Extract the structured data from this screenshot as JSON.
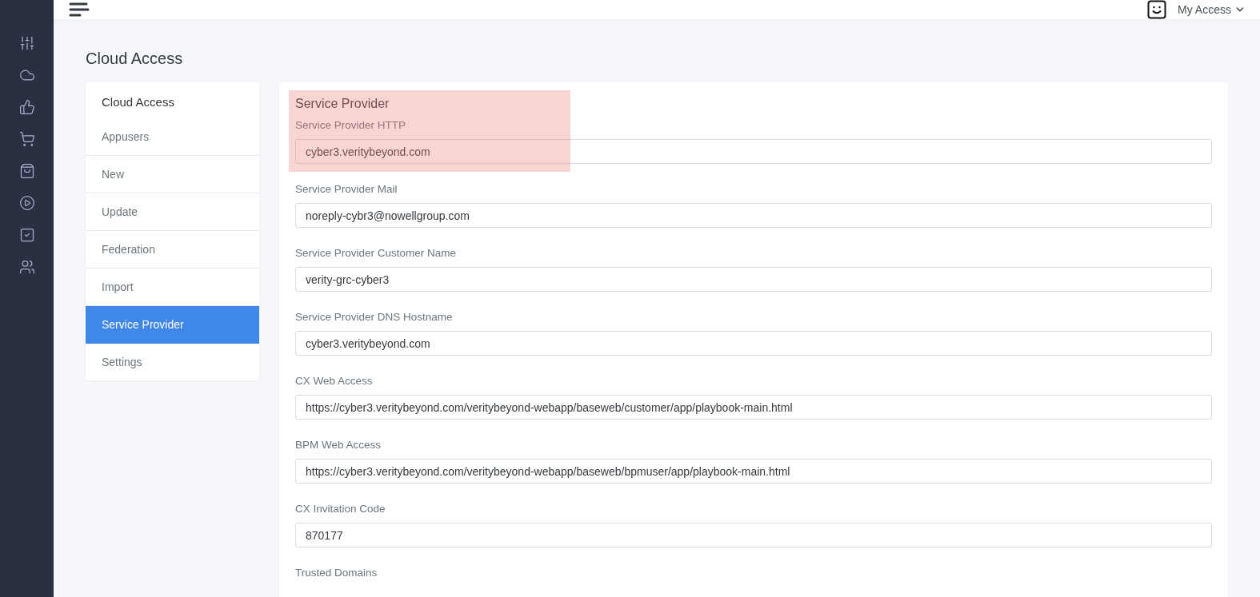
{
  "header": {
    "user_menu": "My Access"
  },
  "page_title": "Cloud Access",
  "menu": {
    "title": "Cloud Access",
    "items": [
      {
        "label": "Appusers",
        "selected": false
      },
      {
        "label": "New",
        "selected": false
      },
      {
        "label": "Update",
        "selected": false
      },
      {
        "label": "Federation",
        "selected": false
      },
      {
        "label": "Import",
        "selected": false
      },
      {
        "label": "Service Provider",
        "selected": true
      },
      {
        "label": "Settings",
        "selected": false
      }
    ]
  },
  "form": {
    "title": "Service Provider",
    "highlighted": true,
    "fields": [
      {
        "label": "Service Provider HTTP",
        "value": "cyber3.veritybeyond.com"
      },
      {
        "label": "Service Provider Mail",
        "value": "noreply-cybr3@nowellgroup.com"
      },
      {
        "label": "Service Provider Customer Name",
        "value": "verity-grc-cyber3"
      },
      {
        "label": "Service Provider DNS Hostname",
        "value": "cyber3.veritybeyond.com"
      },
      {
        "label": "CX Web Access",
        "value": "https://cyber3.veritybeyond.com/veritybeyond-webapp/baseweb/customer/app/playbook-main.html"
      },
      {
        "label": "BPM Web Access",
        "value": "https://cyber3.veritybeyond.com/veritybeyond-webapp/baseweb/bpmuser/app/playbook-main.html"
      },
      {
        "label": "CX Invitation Code",
        "value": "870177"
      },
      {
        "label": "Trusted Domains"
      }
    ]
  }
}
